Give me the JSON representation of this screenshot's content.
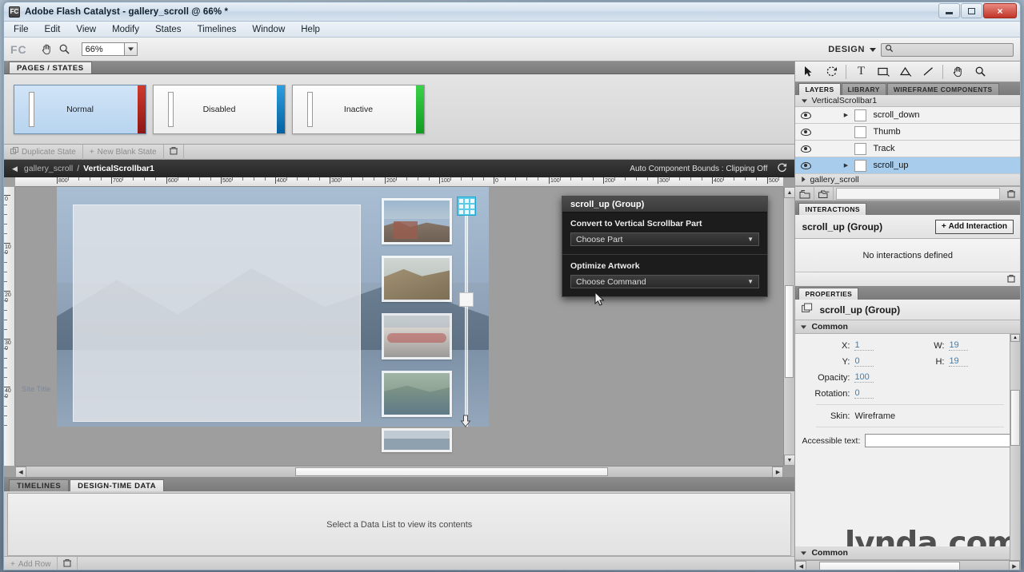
{
  "window": {
    "title": "Adobe Flash Catalyst - gallery_scroll @ 66% *",
    "app_icon": "FC",
    "controls": {
      "minimize": "minimize-icon",
      "maximize": "maximize-icon",
      "close": "×"
    }
  },
  "menubar": {
    "items": [
      "File",
      "Edit",
      "View",
      "Modify",
      "States",
      "Timelines",
      "Window",
      "Help"
    ]
  },
  "toolbar": {
    "logo": "FC",
    "hand_icon": "hand-icon",
    "zoom_icon": "magnifier-icon",
    "zoom_value": "66%",
    "workspace_label": "DESIGN",
    "search_placeholder": ""
  },
  "pages_states": {
    "tab_label": "PAGES / STATES",
    "states": [
      {
        "label": "Normal",
        "selected": true,
        "edge_color": "#b81f1f"
      },
      {
        "label": "Disabled",
        "selected": false,
        "edge_color": "#0d7cc4"
      },
      {
        "label": "Inactive",
        "selected": false,
        "edge_color": "#1aac2e"
      }
    ],
    "buttons": {
      "duplicate": "Duplicate State",
      "new_blank": "New Blank State",
      "delete_icon": "delete-state-icon"
    }
  },
  "artboard": {
    "breadcrumb": {
      "back_icon": "◀",
      "parent": "gallery_scroll",
      "separator": "/",
      "current": "VerticalScrollbar1"
    },
    "status": "Auto Component Bounds : Clipping Off",
    "refresh_icon": "refresh-icon",
    "ruler_h_labels": [
      "800",
      "700",
      "600",
      "500",
      "400",
      "300",
      "200",
      "100",
      "0",
      "100",
      "200",
      "300",
      "400",
      "500"
    ],
    "ruler_v_labels": [
      "0",
      "100",
      "200",
      "300",
      "400"
    ],
    "site_title": "Site Title"
  },
  "context_menu": {
    "header": "scroll_up (Group)",
    "sections": [
      {
        "title": "Convert to Vertical Scrollbar Part",
        "select_value": "Choose Part"
      },
      {
        "title": "Optimize Artwork",
        "select_value": "Choose Command"
      }
    ]
  },
  "bottom_panel": {
    "tabs": [
      {
        "label": "TIMELINES",
        "active": false
      },
      {
        "label": "DESIGN-TIME DATA",
        "active": true
      }
    ],
    "message": "Select a Data List to view its contents",
    "add_row_label": "Add Row",
    "delete_icon": "delete-row-icon"
  },
  "tools": [
    "select-arrow-icon",
    "transform-icon",
    "text-tool-icon",
    "rectangle-tool-icon",
    "polygon-tool-icon",
    "line-tool-icon",
    "hand-tool-icon",
    "zoom-tool-icon"
  ],
  "right_tabs": [
    {
      "label": "LAYERS",
      "active": true
    },
    {
      "label": "LIBRARY",
      "active": false
    },
    {
      "label": "WIREFRAME COMPONENTS",
      "active": false
    }
  ],
  "layers": {
    "group": "VerticalScrollbar1",
    "rows": [
      {
        "name": "scroll_down",
        "disclosure": true,
        "selected": false
      },
      {
        "name": "Thumb",
        "disclosure": false,
        "selected": false
      },
      {
        "name": "Track",
        "disclosure": false,
        "selected": false
      },
      {
        "name": "scroll_up",
        "disclosure": true,
        "selected": true
      }
    ],
    "footer_group": "gallery_scroll",
    "footer_icons": [
      "new-group-icon",
      "duplicate-layer-icon",
      "trash-icon"
    ]
  },
  "interactions": {
    "tab_label": "INTERACTIONS",
    "target": "scroll_up (Group)",
    "add_button": "Add Interaction",
    "empty_message": "No interactions defined",
    "trash_icon": "trash-icon"
  },
  "properties": {
    "tab_label": "PROPERTIES",
    "target": "scroll_up (Group)",
    "target_icon": "group-icon",
    "section": "Common",
    "fields": [
      {
        "label": "X:",
        "value": "1"
      },
      {
        "label": "W:",
        "value": "19"
      },
      {
        "label": "Y:",
        "value": "0"
      },
      {
        "label": "H:",
        "value": "19"
      },
      {
        "label": "Opacity:",
        "value": "100"
      },
      {
        "label": "Rotation:",
        "value": "0"
      },
      {
        "label": "Skin:",
        "value": "Wireframe"
      }
    ],
    "accessible_text_label": "Accessible text:",
    "accessible_text_value": "",
    "next_section": "Common"
  },
  "watermark": "lynda.com",
  "colors": {
    "accent_blue": "#a8cdec",
    "value_blue": "#3e7fb5",
    "panel_gray": "#cfcfcf",
    "dark_popup": "#1c1c1c"
  }
}
